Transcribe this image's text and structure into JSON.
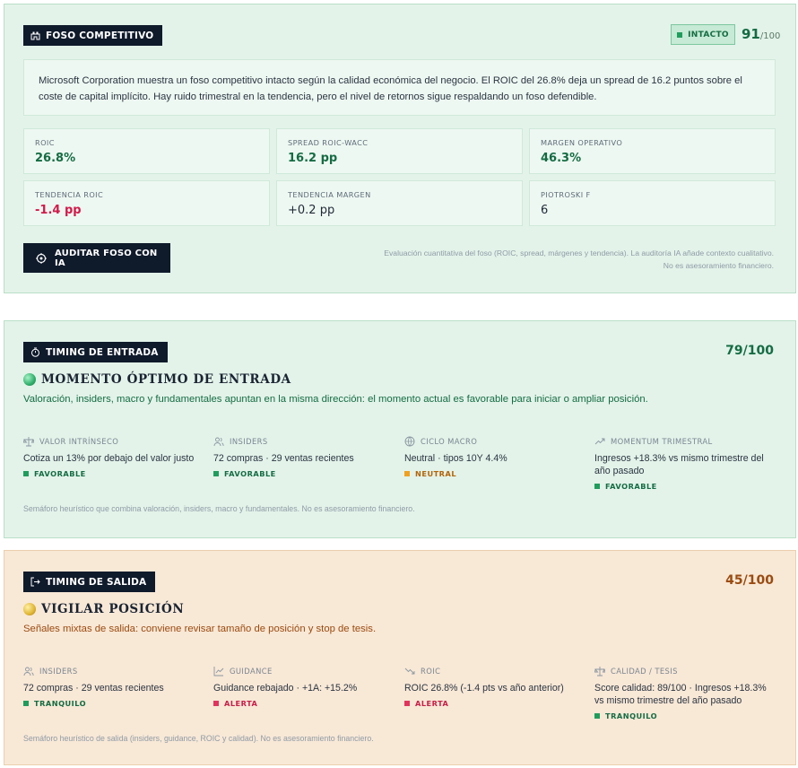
{
  "moat": {
    "tag": "FOSO COMPETITIVO",
    "badge": "INTACTO",
    "score": "91",
    "score_den": "/100",
    "summary": "Microsoft Corporation muestra un foso competitivo intacto según la calidad económica del negocio. El ROIC del 26.8% deja un spread de 16.2 puntos sobre el coste de capital implícito. Hay ruido trimestral en la tendencia, pero el nivel de retornos sigue respaldando un foso defendible.",
    "metrics": [
      {
        "label": "ROIC",
        "value": "26.8%"
      },
      {
        "label": "SPREAD ROIC-WACC",
        "value": "16.2 pp"
      },
      {
        "label": "MARGEN OPERATIVO",
        "value": "46.3%"
      },
      {
        "label": "TENDENCIA ROIC",
        "value": "-1.4 pp"
      },
      {
        "label": "TENDENCIA MARGEN",
        "value": "+0.2 pp"
      },
      {
        "label": "PIOTROSKI F",
        "value": "6"
      }
    ],
    "button": "AUDITAR FOSO CON IA",
    "note": "Evaluación cuantitativa del foso (ROIC, spread, márgenes y tendencia). La auditoría IA añade contexto cualitativo. No es asesoramiento financiero."
  },
  "entry": {
    "tag": "TIMING DE ENTRADA",
    "score": "79/100",
    "heading": "MOMENTO ÓPTIMO DE ENTRADA",
    "subline": "Valoración, insiders, macro y fundamentales apuntan en la misma dirección: el momento actual es favorable para iniciar o ampliar posición.",
    "signals": [
      {
        "label": "VALOR INTRÍNSECO",
        "text": "Cotiza un 13% por debajo del valor justo",
        "status": "FAVORABLE"
      },
      {
        "label": "INSIDERS",
        "text": "72 compras · 29 ventas recientes",
        "status": "FAVORABLE"
      },
      {
        "label": "CICLO MACRO",
        "text": "Neutral · tipos 10Y 4.4%",
        "status": "NEUTRAL"
      },
      {
        "label": "MOMENTUM TRIMESTRAL",
        "text": "Ingresos +18.3% vs mismo trimestre del año pasado",
        "status": "FAVORABLE"
      }
    ],
    "foot": "Semáforo heurístico que combina valoración, insiders, macro y fundamentales. No es asesoramiento financiero."
  },
  "exit": {
    "tag": "TIMING DE SALIDA",
    "score": "45/100",
    "heading": "VIGILAR POSICIÓN",
    "subline": "Señales mixtas de salida: conviene revisar tamaño de posición y stop de tesis.",
    "signals": [
      {
        "label": "INSIDERS",
        "text": "72 compras · 29 ventas recientes",
        "status": "TRANQUILO"
      },
      {
        "label": "GUIDANCE",
        "text": "Guidance rebajado · +1A: +15.2%",
        "status": "ALERTA"
      },
      {
        "label": "ROIC",
        "text": "ROIC 26.8% (-1.4 pts vs año anterior)",
        "status": "ALERTA"
      },
      {
        "label": "CALIDAD / TESIS",
        "text": "Score calidad: 89/100 · Ingresos +18.3% vs mismo trimestre del año pasado",
        "status": "TRANQUILO"
      }
    ],
    "foot": "Semáforo heurístico de salida (insiders, guidance, ROIC y calidad). No es asesoramiento financiero."
  },
  "colors": {
    "green": "#146c43",
    "alert": "#c81d47",
    "neutral": "#b3640a",
    "dark": "#0f1a2b"
  }
}
